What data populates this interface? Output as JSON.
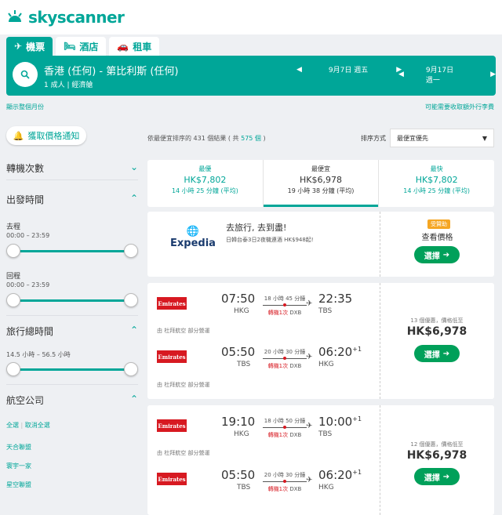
{
  "brand": {
    "name": "skyscanner"
  },
  "tabs": [
    {
      "label": "機票",
      "icon": "plane-icon"
    },
    {
      "label": "酒店",
      "icon": "bed-icon"
    },
    {
      "label": "租車",
      "icon": "car-icon"
    }
  ],
  "search": {
    "route": "香港 (任何) - 第比利斯 (任何)",
    "pax": "1 成人 | 經濟艙",
    "depart": "9月7日 週五",
    "return": "9月17日 週一"
  },
  "subbar": {
    "left": "顯示整個月份",
    "right": "可能需要收取額外行李費"
  },
  "sidebar": {
    "alert": "獲取價格通知",
    "stops": "轉機次數",
    "times": "出發時間",
    "outbound": "去程",
    "outbound_range": "00:00 – 23:59",
    "inbound": "回程",
    "inbound_range": "00:00 – 23:59",
    "duration": "旅行總時間",
    "duration_range": "14.5 小時 – 56.5 小時",
    "airlines": "航空公司",
    "select_all": "全選",
    "clear_all": "取消全選",
    "alliances": [
      "天合聯盟",
      "寰宇一家",
      "星空聯盟"
    ]
  },
  "results": {
    "prefix": "依最便宜排序的 431 個結果 ( 共 ",
    "total": "575 個",
    "suffix": " )",
    "sort_label": "排序方式",
    "sort_value": "最便宜優先"
  },
  "summary": [
    {
      "title": "最優",
      "price": "HK$7,802",
      "dur": "14 小時 25 分鐘 (平均)"
    },
    {
      "title": "最便宜",
      "price": "HK$6,978",
      "dur": "19 小時 38 分鐘 (平均)"
    },
    {
      "title": "最快",
      "price": "HK$7,802",
      "dur": "14 小時 25 分鐘 (平均)"
    }
  ],
  "ad": {
    "brand": "Expedia",
    "headline": "去旅行, 去到盡!",
    "text": "日韓台泰3日2夜機連酒 HK$948起!",
    "badge": "受贊助",
    "cta": "查看價格",
    "select": "選擇"
  },
  "flights": [
    {
      "logo": "Emirates",
      "dep": "07:50",
      "from": "HKG",
      "dur": "18 小時 45 分鐘",
      "stop": "轉機1次",
      "via": "DXB",
      "arr": "22:35",
      "to": "TBS",
      "plus": "",
      "dep2": "05:50",
      "from2": "TBS",
      "dur2": "20 小時 30 分鐘",
      "stop2": "轉機1次",
      "via2": "DXB",
      "arr2": "06:20",
      "to2": "HKG",
      "plus2": "+1",
      "carrier": "由 杜拜航空 部分營運",
      "deals": "13 個優惠，價格低至",
      "price": "HK$6,978",
      "select": "選擇"
    },
    {
      "logo": "Emirates",
      "dep": "19:10",
      "from": "HKG",
      "dur": "18 小時 50 分鐘",
      "stop": "轉機1次",
      "via": "DXB",
      "arr": "10:00",
      "to": "TBS",
      "plus": "+1",
      "dep2": "05:50",
      "from2": "TBS",
      "dur2": "20 小時 30 分鐘",
      "stop2": "轉機1次",
      "via2": "DXB",
      "arr2": "06:20",
      "to2": "HKG",
      "plus2": "+1",
      "carrier": "由 杜拜航空 部分營運",
      "deals": "12 個優惠，價格低至",
      "price": "HK$6,978",
      "select": "選擇"
    }
  ],
  "colors": {
    "brand": "#00a698",
    "select": "#00a05a",
    "emirates": "#d71921"
  }
}
